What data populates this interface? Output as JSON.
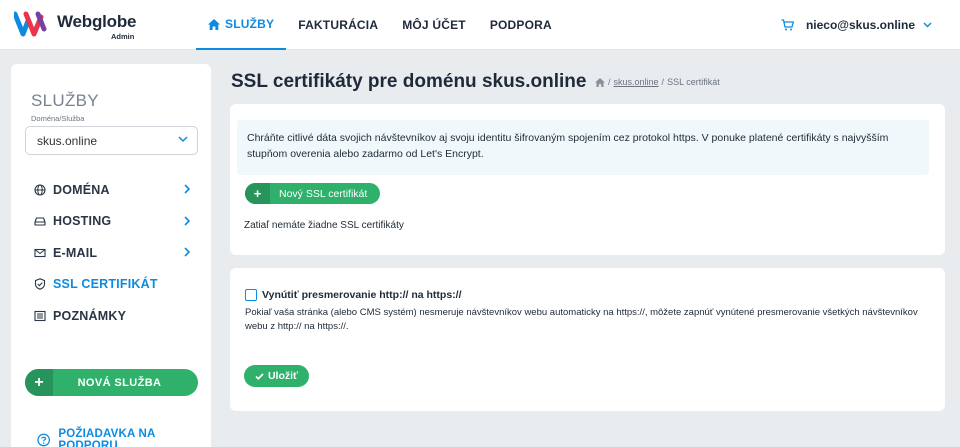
{
  "brand": {
    "name": "Webglobe",
    "sub": "Admin",
    "colors": {
      "blue": "#0d8be0",
      "red": "#e8344e",
      "navy": "#1e2a3a"
    }
  },
  "nav": {
    "items": [
      {
        "label": "SLUŽBY",
        "active": true,
        "icon": "home-icon"
      },
      {
        "label": "FAKTURÁCIA"
      },
      {
        "label": "MÔJ ÚČET"
      },
      {
        "label": "PODPORA"
      }
    ]
  },
  "user": {
    "email": "nieco@skus.online",
    "cart_icon": "cart-icon"
  },
  "sidebar": {
    "title": "SLUŽBY",
    "select_label": "Doména/Služba",
    "select_value": "skus.online",
    "items": [
      {
        "label": "DOMÉNA",
        "icon": "globe-icon",
        "has_arrow": true
      },
      {
        "label": "HOSTING",
        "icon": "server-icon",
        "has_arrow": true
      },
      {
        "label": "E-MAIL",
        "icon": "mail-icon",
        "has_arrow": true
      },
      {
        "label": "SSL CERTIFIKÁT",
        "icon": "shield-icon",
        "active": true
      },
      {
        "label": "POZNÁMKY",
        "icon": "notes-icon"
      }
    ],
    "new_service_label": "NOVÁ SLUŽBA",
    "support_label": "POŽIADAVKA NA PODPORU"
  },
  "page": {
    "title": "SSL certifikáty pre doménu skus.online",
    "breadcrumb": {
      "domain": "skus.online",
      "current": "SSL certifikát"
    }
  },
  "ssl_card": {
    "info": "Chráňte citlivé dáta svojich návštevníkov aj svoju identitu šifrovaným spojením cez protokol https. V ponuke platené certifikáty s najvyšším stupňom overenia alebo zadarmo od Let's Encrypt.",
    "new_button_label": "Nový SSL certifikát",
    "empty_text": "Zatiaľ nemáte žiadne SSL certifikáty"
  },
  "redirect_card": {
    "checkbox_label": "Vynútiť presmerovanie http:// na https://",
    "checked": false,
    "description": "Pokiaľ vaša stránka (alebo CMS systém) nesmeruje návštevníkov webu automaticky na https://, môžete zapnúť vynútené presmerovanie všetkých návštevníkov webu z http:// na https://.",
    "save_label": "Uložiť"
  },
  "accent_green": "#2fb06b"
}
